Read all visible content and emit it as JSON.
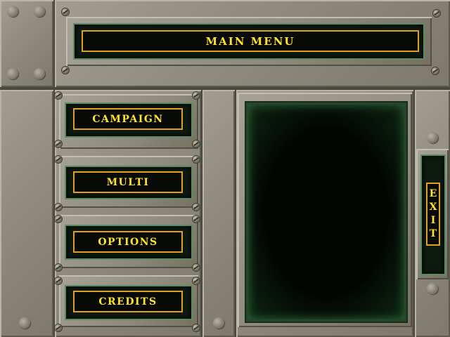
{
  "title": "MAIN MENU",
  "menu": {
    "campaign": "CAMPAIGN",
    "multi": "MULTI",
    "options": "OPTIONS",
    "credits": "CREDITS"
  },
  "exit": [
    "E",
    "X",
    "I",
    "T"
  ],
  "colors": {
    "label_text": "#ffe22a",
    "label_border": "#e0a020",
    "panel_metal": "#8f8b7e",
    "screen_glow": "#2f6a3a"
  }
}
